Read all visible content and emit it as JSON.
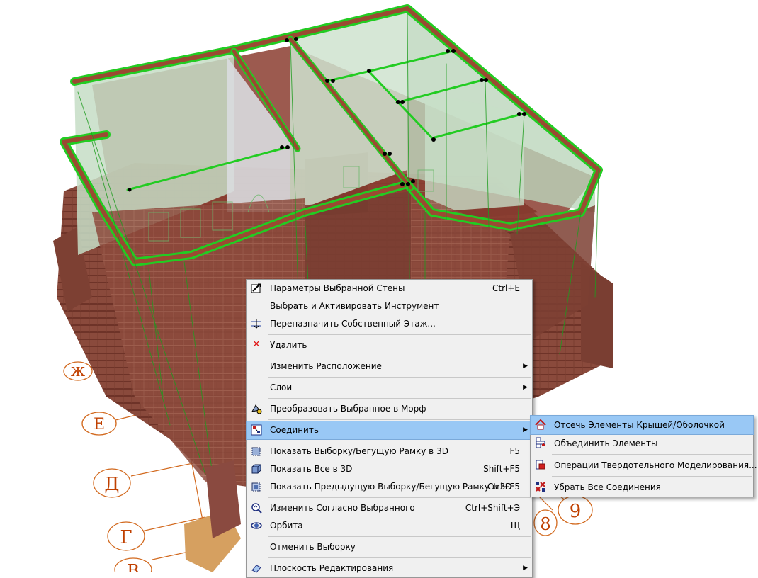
{
  "scene": {
    "grid_labels_left": [
      "Ж",
      "Е",
      "Д",
      "Г",
      "В"
    ],
    "grid_labels_bottom": [
      "8",
      "9"
    ]
  },
  "context_menu": {
    "items": [
      {
        "label": "Параметры Выбранной Стены",
        "shortcut": "Ctrl+E",
        "icon": "wall-settings-icon"
      },
      {
        "label": "Выбрать и Активировать Инструмент",
        "shortcut": "",
        "icon": ""
      },
      {
        "label": "Переназначить Собственный Этаж...",
        "shortcut": "",
        "icon": "story-icon"
      },
      {
        "label": "Удалить",
        "shortcut": "",
        "icon": "delete-icon"
      },
      {
        "label": "Изменить Расположение",
        "shortcut": "",
        "icon": "",
        "submenu": true
      },
      {
        "label": "Слои",
        "shortcut": "",
        "icon": "",
        "submenu": true
      },
      {
        "label": "Преобразовать Выбранное в Морф",
        "shortcut": "",
        "icon": "morph-icon"
      },
      {
        "label": "Соединить",
        "shortcut": "",
        "icon": "connect-icon",
        "submenu": true,
        "highlighted": true
      },
      {
        "label": "Показать Выборку/Бегущую Рамку в 3D",
        "shortcut": "F5",
        "icon": "show-selection-3d-icon"
      },
      {
        "label": "Показать Все в 3D",
        "shortcut": "Shift+F5",
        "icon": "show-all-3d-icon"
      },
      {
        "label": "Показать Предыдущую Выборку/Бегущую Рамку в 3D",
        "shortcut": "Ctrl+F5",
        "icon": "show-previous-3d-icon"
      },
      {
        "label": "Изменить Согласно Выбранного",
        "shortcut": "Ctrl+Shift+Э",
        "icon": "modify-icon"
      },
      {
        "label": "Орбита",
        "shortcut": "Щ",
        "icon": "orbit-icon"
      },
      {
        "label": "Отменить Выборку",
        "shortcut": "",
        "icon": ""
      },
      {
        "label": "Плоскость Редактирования",
        "shortcut": "",
        "icon": "editing-plane-icon",
        "submenu": true
      }
    ]
  },
  "submenu": {
    "items": [
      {
        "label": "Отсечь Элементы Крышей/Оболочкой",
        "icon": "trim-to-roof-icon",
        "highlighted": true
      },
      {
        "label": "Объединить Элементы",
        "icon": "merge-elements-icon"
      },
      {
        "label": "Операции Твердотельного Моделирования...",
        "icon": "solid-operations-icon"
      },
      {
        "label": "Убрать Все Соединения",
        "icon": "remove-connections-icon"
      }
    ]
  },
  "colors": {
    "highlight": "#99c8f5",
    "wall_outline": "#22cc22",
    "brick": "#8b3d30",
    "grid_line": "#d2691e"
  }
}
